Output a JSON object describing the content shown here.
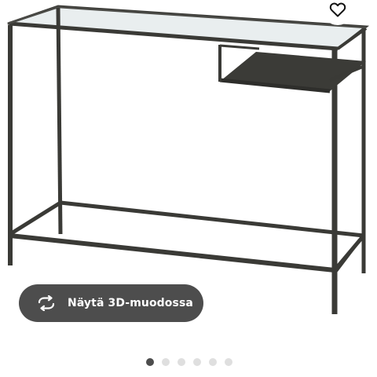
{
  "product_viewer": {
    "image_alt": "VITTSJÖ desk with glass top and black-brown frame",
    "favorite": {
      "icon": "heart-outline-icon"
    },
    "view_3d": {
      "icon": "rotate-arrows-icon",
      "label": "Näytä 3D-muodossa"
    },
    "pagination": {
      "total": 6,
      "active_index": 0
    }
  },
  "colors": {
    "frame": "#3a3a36",
    "glass": "#e9eeef",
    "button_bg": "#4d4d4d",
    "dot_active": "#4d4d4d",
    "dot_inactive": "#dfdfdf"
  }
}
